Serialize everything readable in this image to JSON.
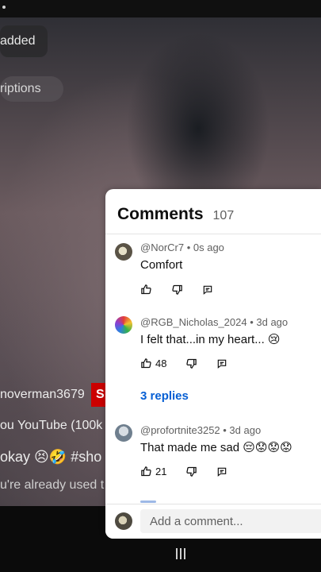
{
  "background": {
    "pill_added": "added",
    "pill_subscriptions": "riptions",
    "channel_name": "noverman3679",
    "subscribe_letter": "S",
    "line1": "ou YouTube (100k",
    "line2": " okay 😣🤣 #sho",
    "line3": "u're already used t"
  },
  "comments_panel": {
    "title": "Comments",
    "count": "107",
    "comments": [
      {
        "author_time": "@NorCr7 • 0s ago",
        "text": "Comfort",
        "likes": ""
      },
      {
        "author_time": "@RGB_Nicholas_2024 • 3d ago",
        "text": "I felt that...in my heart... 😢",
        "likes": "48",
        "replies": "3 replies"
      },
      {
        "author_time": "@profortnite3252 • 3d ago",
        "text": "That  made me sad 😔😟😟😟",
        "likes": "21"
      }
    ],
    "add_comment_placeholder": "Add a comment..."
  },
  "colors": {
    "accent_link": "#065fd4",
    "subscribe_red": "#cc0000",
    "panel_bg": "#ffffff"
  },
  "icons": [
    "thumb-up-icon",
    "thumb-down-icon",
    "reply-icon",
    "nav-handle-icon"
  ]
}
